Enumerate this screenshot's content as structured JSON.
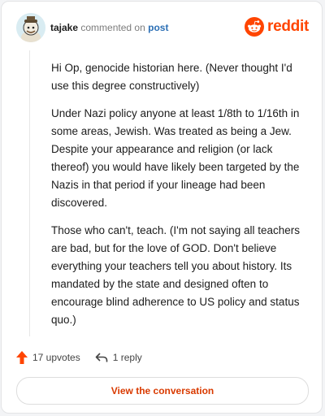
{
  "comment": {
    "username": "tajake",
    "action_text": "commented on",
    "target_text": "post",
    "paragraphs": [
      "Hi Op, genocide historian here. (Never thought I'd use this degree constructively)",
      "Under Nazi policy anyone at least 1/8th to 1/16th in some areas, Jewish. Was treated as being a Jew. Despite your appearance and religion (or lack thereof) you would have likely been targeted by the Nazis in that period if your lineage had been discovered.",
      "Those who can't, teach. (I'm not saying all teachers are bad, but for the love of GOD. Don't believe everything your teachers tell you about history. Its mandated by the state and designed often to encourage blind adherence to US policy and status quo.)"
    ]
  },
  "brand": {
    "wordmark": "reddit",
    "icon": "reddit-logo-icon",
    "color": "#ff4500"
  },
  "actions": {
    "upvotes_label": "17 upvotes",
    "upvote_icon": "upvote-arrow-icon",
    "reply_label": "1 reply",
    "reply_icon": "reply-arrow-icon"
  },
  "footer": {
    "view_button_label": "View the conversation"
  },
  "colors": {
    "accent": "#ff4500",
    "link": "#2b6fb5",
    "button_text": "#d93a00"
  }
}
